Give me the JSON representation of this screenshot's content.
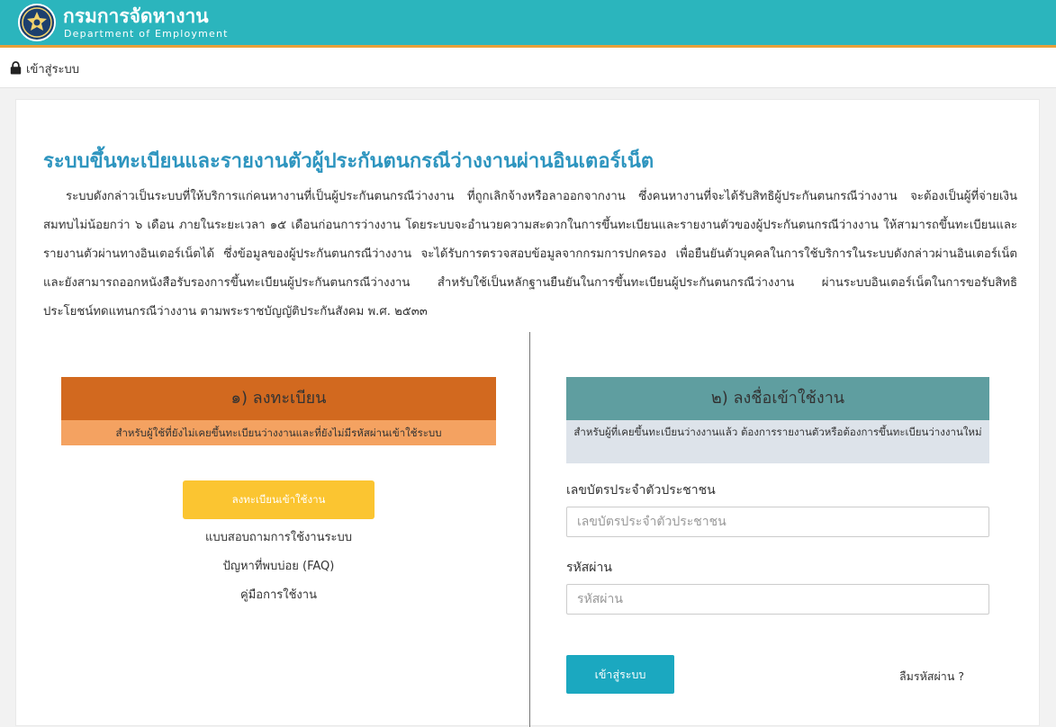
{
  "header": {
    "title_th": "กรมการจัดหางาน",
    "title_en": "Department of Employment",
    "logo_icon": "department-seal-icon",
    "bg_color": "#2bb5bd",
    "accent_color": "#e8a03a"
  },
  "topbar": {
    "icon": "lock-icon",
    "login_label": "เข้าสู่ระบบ"
  },
  "main": {
    "title": "ระบบขึ้นทะเบียนและรายงานตัวผู้ประกันตนกรณีว่างงานผ่านอินเตอร์เน็ต",
    "description": "ระบบดังกล่าวเป็นระบบที่ให้บริการแก่คนหางานที่เป็นผู้ประกันตนกรณีว่างงาน ที่ถูกเลิกจ้างหรือลาออกจากงาน ซึ่งคนหางานที่จะได้รับสิทธิผู้ประกันตนกรณีว่างงาน จะต้องเป็นผู้ที่จ่ายเงินสมทบไม่น้อยกว่า ๖ เดือน ภายในระยะเวลา ๑๕ เดือนก่อนการว่างงาน โดยระบบจะอำนวยความสะดวกในการขึ้นทะเบียนและรายงานตัวของผู้ประกันตนกรณีว่างงาน ให้สามารถขึ้นทะเบียนและรายงานตัวผ่านทางอินเตอร์เน็ตได้ ซึ่งข้อมูลของผู้ประกันตนกรณีว่างงาน จะได้รับการตรวจสอบข้อมูลจากกรมการปกครอง เพื่อยืนยันตัวบุคคลในการใช้บริการในระบบดังกล่าวผ่านอินเตอร์เน็ต และยังสามารถออกหนังสือรับรองการขึ้นทะเบียนผู้ประกันตนกรณีว่างงาน สำหรับใช้เป็นหลักฐานยืนยันในการขึ้นทะเบียนผู้ประกันตนกรณีว่างงาน ผ่านระบบอินเตอร์เน็ตในการขอรับสิทธิประโยชน์ทดแทนกรณีว่างงาน ตามพระราชบัญญัติประกันสังคม พ.ศ. ๒๕๓๓",
    "title_color": "#2e95bf"
  },
  "register": {
    "heading": "๑) ลงทะเบียน",
    "subheading": "สำหรับผู้ใช้ที่ยังไม่เคยขึ้นทะเบียนว่างงานและที่ยังไม่มีรหัสผ่านเข้าใช้ระบบ",
    "button_label": "ลงทะเบียนเข้าใช้งาน",
    "links": [
      "แบบสอบถามการใช้งานระบบ",
      "ปัญหาที่พบบ่อย (FAQ)",
      "คู่มือการใช้งาน"
    ],
    "head_color": "#d2691f",
    "sub_color": "#f4a261",
    "button_color": "#fbc531"
  },
  "login": {
    "heading": "๒) ลงชื่อเข้าใช้งาน",
    "subheading": "สำหรับผู้ที่เคยขึ้นทะเบียนว่างงานแล้ว ต้องการรายงานตัวหรือต้องการขึ้นทะเบียนว่างงานใหม่",
    "id_label": "เลขบัตรประจำตัวประชาชน",
    "id_placeholder": "เลขบัตรประจำตัวประชาชน",
    "id_value": "",
    "password_label": "รหัสผ่าน",
    "password_placeholder": "รหัสผ่าน",
    "password_value": "",
    "button_label": "เข้าสู่ระบบ",
    "forgot_label": "ลืมรหัสผ่าน ?",
    "head_color": "#5f9ea0",
    "sub_color": "#dde3ea",
    "button_color": "#1ba8c0"
  }
}
